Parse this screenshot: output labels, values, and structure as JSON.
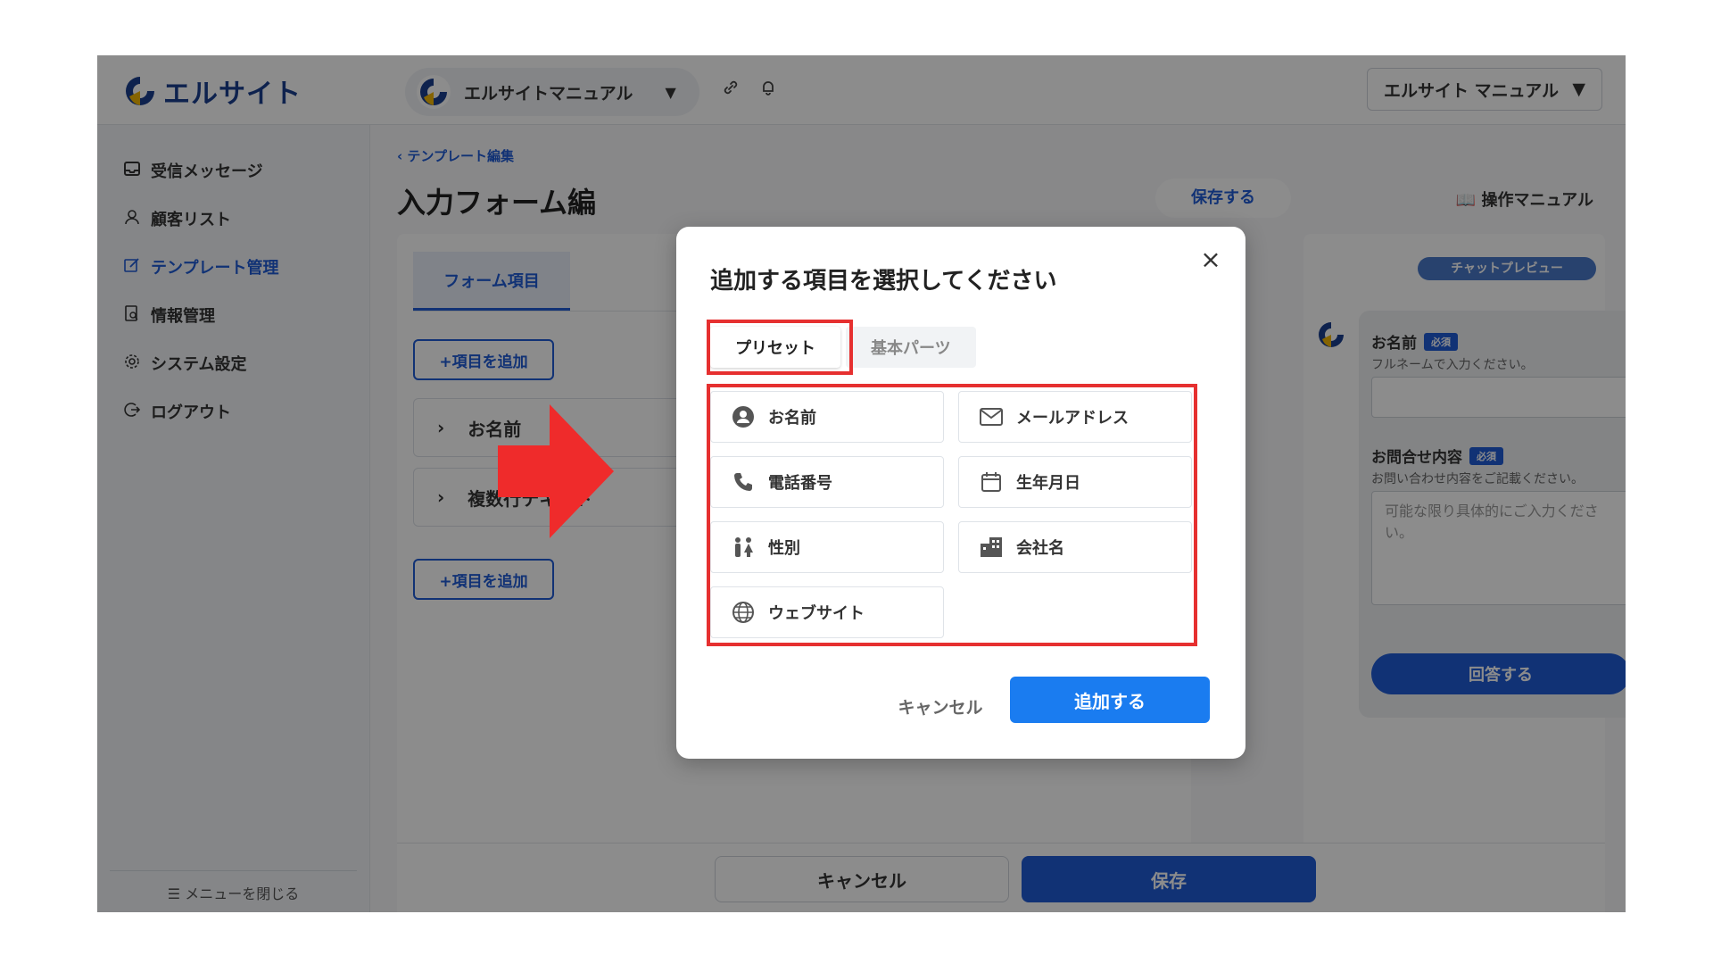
{
  "app": {
    "logo_text": "エルサイト"
  },
  "header": {
    "account_name": "エルサイトマニュアル",
    "account_select": "エルサイト マニュアル",
    "caret": "▼"
  },
  "sidebar": {
    "items": [
      {
        "label": "受信メッセージ",
        "icon": "inbox-icon"
      },
      {
        "label": "顧客リスト",
        "icon": "user-icon"
      },
      {
        "label": "テンプレート管理",
        "icon": "edit-icon"
      },
      {
        "label": "情報管理",
        "icon": "document-search-icon"
      },
      {
        "label": "システム設定",
        "icon": "gear-icon"
      },
      {
        "label": "ログアウト",
        "icon": "logout-icon"
      }
    ],
    "close_menu": "メニューを閉じる"
  },
  "main": {
    "breadcrumb": "テンプレート編集",
    "page_title": "入力フォーム編",
    "save_link": "保存する",
    "manual_link": "操作マニュアル",
    "tab_form": "フォーム項目",
    "add_item": "+項目を追加",
    "rows": [
      "お名前",
      "複数行テキスト"
    ]
  },
  "preview": {
    "badge": "チャットプレビュー",
    "field1_label": "お名前",
    "field1_help": "フルネームで入力ください。",
    "field2_label": "お問合せ内容",
    "field2_help": "お問い合わせ内容をご記載ください。",
    "field2_placeholder": "可能な限り具体的にご入力ください。",
    "required": "必須",
    "answer": "回答する"
  },
  "footer": {
    "cancel": "キャンセル",
    "save": "保存"
  },
  "modal": {
    "title": "追加する項目を選択してください",
    "close": "×",
    "tabs": [
      "プリセット",
      "基本パーツ"
    ],
    "options": [
      {
        "label": "お名前",
        "icon": "person-icon"
      },
      {
        "label": "メールアドレス",
        "icon": "mail-icon"
      },
      {
        "label": "電話番号",
        "icon": "phone-icon"
      },
      {
        "label": "生年月日",
        "icon": "calendar-icon"
      },
      {
        "label": "性別",
        "icon": "gender-icon"
      },
      {
        "label": "会社名",
        "icon": "building-icon"
      },
      {
        "label": "ウェブサイト",
        "icon": "globe-icon"
      }
    ],
    "cancel": "キャンセル",
    "add": "追加する"
  },
  "colors": {
    "accent": "#1f5bd6",
    "highlight": "#e63030",
    "modal_primary": "#1a7cf0"
  }
}
